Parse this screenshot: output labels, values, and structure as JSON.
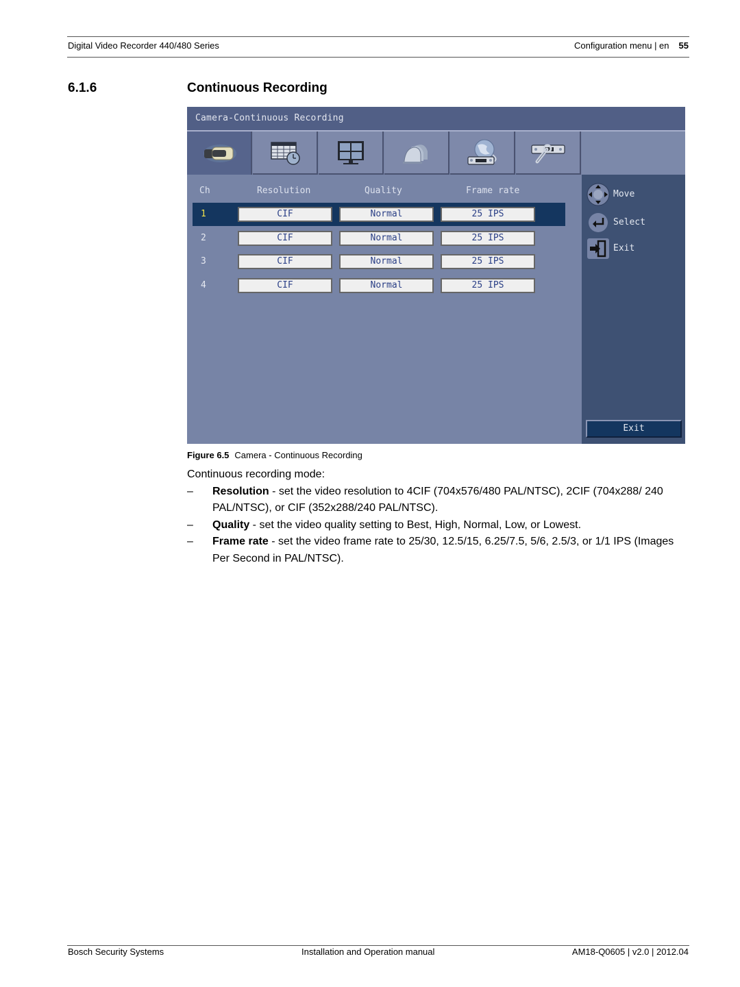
{
  "header": {
    "doc_title": "Digital Video Recorder 440/480 Series",
    "section_label": "Configuration menu | en",
    "page_number": "55"
  },
  "section": {
    "number": "6.1.6",
    "title": "Continuous Recording"
  },
  "dvr_screen": {
    "title": "Camera-Continuous Recording",
    "tabs": [
      {
        "icon": "camera-icon",
        "active": true
      },
      {
        "icon": "schedule-calendar-icon",
        "active": false
      },
      {
        "icon": "monitor-display-icon",
        "active": false
      },
      {
        "icon": "dome-cameras-icon",
        "active": false
      },
      {
        "icon": "network-globe-icon",
        "active": false
      },
      {
        "icon": "system-tools-icon",
        "active": false
      }
    ],
    "columns": {
      "ch": "Ch",
      "resolution": "Resolution",
      "quality": "Quality",
      "frame_rate": "Frame rate"
    },
    "rows": [
      {
        "ch": "1",
        "resolution": "CIF",
        "quality": "Normal",
        "frame_rate": "25 IPS",
        "selected": true
      },
      {
        "ch": "2",
        "resolution": "CIF",
        "quality": "Normal",
        "frame_rate": "25 IPS",
        "selected": false
      },
      {
        "ch": "3",
        "resolution": "CIF",
        "quality": "Normal",
        "frame_rate": "25 IPS",
        "selected": false
      },
      {
        "ch": "4",
        "resolution": "CIF",
        "quality": "Normal",
        "frame_rate": "25 IPS",
        "selected": false
      }
    ],
    "help": [
      {
        "icon": "dpad-icon",
        "label": "Move"
      },
      {
        "icon": "enter-icon",
        "label": "Select"
      },
      {
        "icon": "exit-door-icon",
        "label": "Exit"
      }
    ],
    "exit_button": "Exit"
  },
  "figure": {
    "label": "Figure 6.5",
    "caption": "Camera - Continuous Recording"
  },
  "content": {
    "intro": "Continuous recording mode:",
    "bullets": [
      {
        "dash": "–",
        "term": "Resolution",
        "text": " - set the video resolution to 4CIF (704x576/480 PAL/NTSC), 2CIF (704x288/ 240 PAL/NTSC), or CIF (352x288/240 PAL/NTSC)."
      },
      {
        "dash": "–",
        "term": "Quality",
        "text": " - set the video quality setting to Best, High, Normal, Low, or Lowest."
      },
      {
        "dash": "–",
        "term": "Frame rate",
        "text": " - set the video frame rate to 25/30, 12.5/15, 6.25/7.5, 5/6, 2.5/3, or 1/1 IPS (Images Per Second in PAL/NTSC)."
      }
    ]
  },
  "footer": {
    "left": "Bosch Security Systems",
    "center": "Installation and Operation manual",
    "right": "AM18-Q0605 | v2.0 | 2012.04"
  }
}
